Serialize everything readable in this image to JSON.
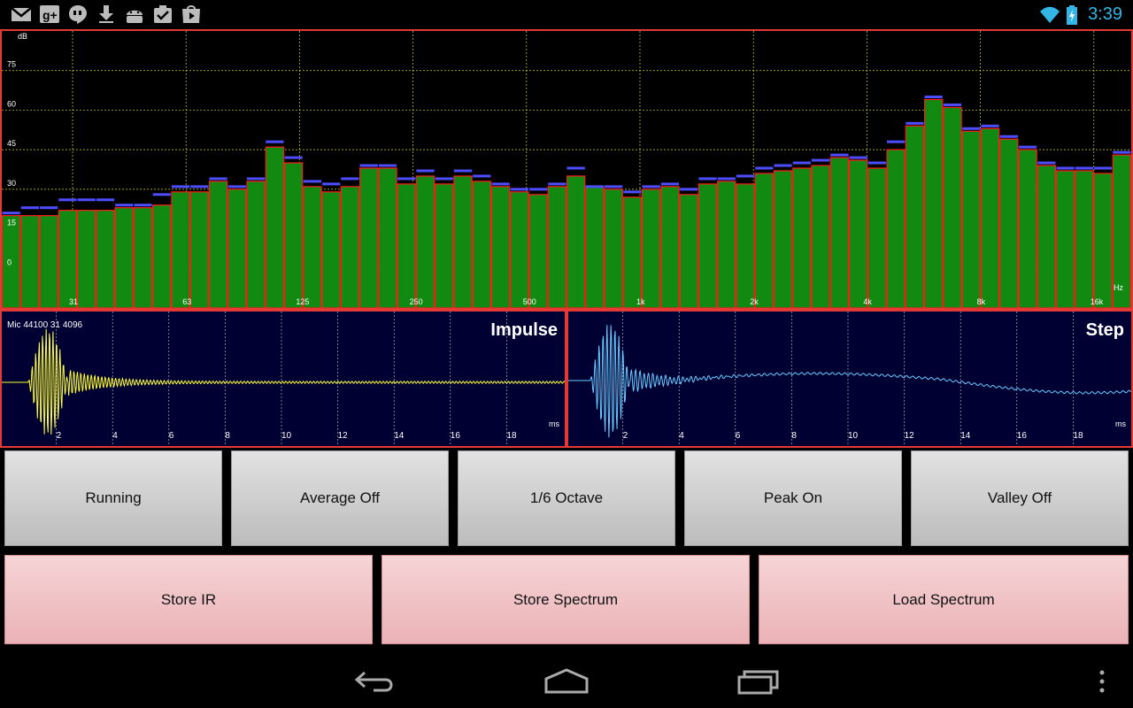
{
  "status_bar": {
    "time": "3:39",
    "icons": [
      "gmail-icon",
      "google-plus-icon",
      "hangouts-icon",
      "download-icon",
      "android-icon",
      "task-icon",
      "play-store-icon"
    ],
    "right_icons": [
      "wifi-icon",
      "battery-charging-icon"
    ]
  },
  "spectrum": {
    "unit": "dB",
    "x_unit": "Hz",
    "y_ticks": [
      "75",
      "60",
      "45",
      "30",
      "15",
      "0"
    ],
    "x_ticks": [
      "31",
      "63",
      "125",
      "250",
      "500",
      "1k",
      "2k",
      "4k",
      "8k",
      "16k"
    ],
    "colors": {
      "bar": "#128a12",
      "bar_edge": "#ff1a1a",
      "peak": "#4d4dff",
      "grid": "#d6d63a"
    }
  },
  "chart_data": [
    {
      "type": "bar",
      "title": "",
      "xlabel": "Hz",
      "ylabel": "dB",
      "ylim": [
        -15,
        90
      ],
      "grid": true,
      "series": [
        {
          "name": "",
          "values": [
            20,
            20,
            20,
            22,
            22,
            22,
            23,
            23,
            24,
            29,
            29,
            33,
            30,
            33,
            46,
            40,
            31,
            29,
            31,
            38,
            38,
            32,
            35,
            32,
            35,
            33,
            31,
            29,
            28,
            31,
            35,
            31,
            30,
            27,
            30,
            31,
            28,
            32,
            33,
            32,
            36,
            37,
            38,
            39,
            42,
            41,
            38,
            45,
            54,
            64,
            61,
            52,
            53,
            49,
            45,
            39,
            37,
            37,
            36,
            43
          ]
        },
        {
          "name": "Peak",
          "values": [
            21,
            23,
            23,
            26,
            26,
            26,
            24,
            24,
            28,
            31,
            31,
            34,
            31,
            34,
            48,
            42,
            33,
            32,
            34,
            39,
            39,
            34,
            37,
            34,
            37,
            35,
            32,
            30,
            30,
            32,
            38,
            31,
            31,
            29,
            31,
            32,
            30,
            34,
            34,
            35,
            38,
            39,
            40,
            41,
            43,
            42,
            40,
            48,
            55,
            65,
            62,
            53,
            54,
            50,
            46,
            40,
            38,
            38,
            38,
            44
          ]
        }
      ]
    },
    {
      "type": "line",
      "title": "Impulse",
      "xlabel": "ms",
      "x_ticks": [
        "2",
        "4",
        "6",
        "8",
        "10",
        "12",
        "14",
        "16",
        "18"
      ],
      "xlim": [
        0,
        20
      ]
    },
    {
      "type": "line",
      "title": "Step",
      "xlabel": "ms",
      "x_ticks": [
        "2",
        "4",
        "6",
        "8",
        "10",
        "12",
        "14",
        "16",
        "18"
      ],
      "xlim": [
        0,
        20
      ]
    }
  ],
  "impulse": {
    "title": "Impulse",
    "mic_label": "Mic 44100 31 4096",
    "x_unit": "ms",
    "color": "#ffff33"
  },
  "step": {
    "title": "Step",
    "x_unit": "ms",
    "color": "#66ccff"
  },
  "buttons_row1": [
    {
      "label": "Running"
    },
    {
      "label": "Average Off"
    },
    {
      "label": "1/6 Octave"
    },
    {
      "label": "Peak On"
    },
    {
      "label": "Valley Off"
    }
  ],
  "buttons_row2": [
    {
      "label": "Store IR"
    },
    {
      "label": "Store Spectrum"
    },
    {
      "label": "Load Spectrum"
    }
  ],
  "nav": {
    "icons": [
      "back-icon",
      "home-icon",
      "recent-apps-icon",
      "overflow-menu-icon"
    ]
  }
}
